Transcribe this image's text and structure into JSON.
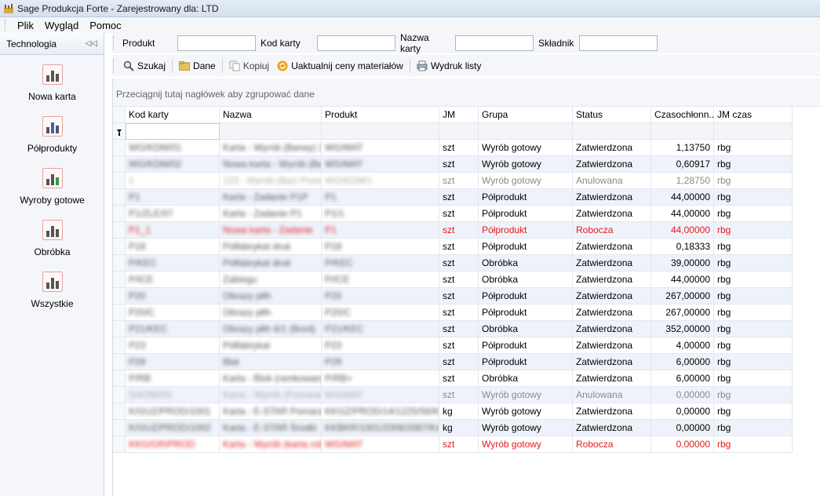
{
  "window": {
    "title": "Sage Produkcja Forte - Zarejestrowany dla: LTD"
  },
  "menu": [
    "Plik",
    "Wygląd",
    "Pomoc"
  ],
  "left_panel": {
    "title": "Technologia",
    "items": [
      {
        "label": "Nowa karta"
      },
      {
        "label": "Półprodukty"
      },
      {
        "label": "Wyroby gotowe"
      },
      {
        "label": "Obróbka"
      },
      {
        "label": "Wszystkie"
      }
    ]
  },
  "search": {
    "produkt_label": "Produkt",
    "produkt_value": "",
    "kod_label": "Kod karty",
    "kod_value": "",
    "nazwa_label": "Nazwa karty",
    "nazwa_value": "",
    "skladnik_label": "Składnik",
    "skladnik_value": ""
  },
  "toolbar": {
    "szukaj": "Szukaj",
    "dane": "Dane",
    "kopiuj": "Kopiuj",
    "uaktualnij": "Uaktualnij ceny materiałów",
    "wydruk": "Wydruk listy"
  },
  "grid": {
    "group_hint": "Przeciągnij tutaj nagłówek aby zgrupować dane",
    "columns": [
      "Kod karty",
      "Nazwa",
      "Produkt",
      "JM",
      "Grupa",
      "Status",
      "Czasochłonn...",
      "JM czas"
    ],
    "rows": [
      {
        "kod": "WG/KDM/01",
        "nazwa": "Karta - Wyrób (Barwy) 1",
        "produkt": "WG/MAT",
        "jm": "szt",
        "grupa": "Wyrób gotowy",
        "status": "Zatwierdzona",
        "czas": "1,13750",
        "jmczas": "rbg",
        "state": "normal"
      },
      {
        "kod": "WG/KDM/02",
        "nazwa": "Nowa karta - Wyrób (Bar)",
        "produkt": "WG/MAT",
        "jm": "szt",
        "grupa": "Wyrób gotowy",
        "status": "Zatwierdzona",
        "czas": "0,60917",
        "jmczas": "rbg",
        "state": "normal"
      },
      {
        "kod": "1",
        "nazwa": "123 - Wyrób (Bar) Pomar",
        "produkt": "WG/KDM/1",
        "jm": "szt",
        "grupa": "Wyrób gotowy",
        "status": "Anulowana",
        "czas": "1,28750",
        "jmczas": "rbg",
        "state": "gray"
      },
      {
        "kod": "P1",
        "nazwa": "Karta - Zadanie P1P",
        "produkt": "P1",
        "jm": "szt",
        "grupa": "Półprodukt",
        "status": "Zatwierdzona",
        "czas": "44,00000",
        "jmczas": "rbg",
        "state": "normal"
      },
      {
        "kod": "P1/ZLE/07",
        "nazwa": "Karta - Zadanie P1",
        "produkt": "P1/1",
        "jm": "szt",
        "grupa": "Półprodukt",
        "status": "Zatwierdzona",
        "czas": "44,00000",
        "jmczas": "rbg",
        "state": "normal"
      },
      {
        "kod": "P1_1",
        "nazwa": "Nowa karta - Zadanie",
        "produkt": "P1",
        "jm": "szt",
        "grupa": "Półprodukt",
        "status": "Robocza",
        "czas": "44,00000",
        "jmczas": "rbg",
        "state": "red"
      },
      {
        "kod": "P18",
        "nazwa": "Półfabrykat druk",
        "produkt": "P18",
        "jm": "szt",
        "grupa": "Półprodukt",
        "status": "Zatwierdzona",
        "czas": "0,18333",
        "jmczas": "rbg",
        "state": "normal"
      },
      {
        "kod": "P/KEC",
        "nazwa": "Półfabrykat druk",
        "produkt": "P/KEC",
        "jm": "szt",
        "grupa": "Obróbka",
        "status": "Zatwierdzona",
        "czas": "39,00000",
        "jmczas": "rbg",
        "state": "normal"
      },
      {
        "kod": "P/ICE",
        "nazwa": "Zabiegu",
        "produkt": "P/ICE",
        "jm": "szt",
        "grupa": "Obróbka",
        "status": "Zatwierdzona",
        "czas": "44,00000",
        "jmczas": "rbg",
        "state": "normal"
      },
      {
        "kod": "P20",
        "nazwa": "Obrazy płth",
        "produkt": "P20",
        "jm": "szt",
        "grupa": "Półprodukt",
        "status": "Zatwierdzona",
        "czas": "267,00000",
        "jmczas": "rbg",
        "state": "normal"
      },
      {
        "kod": "P20/C",
        "nazwa": "Obrazy płth",
        "produkt": "P20/C",
        "jm": "szt",
        "grupa": "Półprodukt",
        "status": "Zatwierdzona",
        "czas": "267,00000",
        "jmczas": "rbg",
        "state": "normal"
      },
      {
        "kod": "P21/KEC",
        "nazwa": "Obrazy płth 6/1 (Bord)",
        "produkt": "P21/KEC",
        "jm": "szt",
        "grupa": "Obróbka",
        "status": "Zatwierdzona",
        "czas": "352,00000",
        "jmczas": "rbg",
        "state": "normal"
      },
      {
        "kod": "P23",
        "nazwa": "Półfabrykat",
        "produkt": "P23",
        "jm": "szt",
        "grupa": "Półprodukt",
        "status": "Zatwierdzona",
        "czas": "4,00000",
        "jmczas": "rbg",
        "state": "normal"
      },
      {
        "kod": "P29",
        "nazwa": "Blat",
        "produkt": "P29",
        "jm": "szt",
        "grupa": "Półprodukt",
        "status": "Zatwierdzona",
        "czas": "6,00000",
        "jmczas": "rbg",
        "state": "normal"
      },
      {
        "kod": "P/RB",
        "nazwa": "Karta - Blok (ramkowany)",
        "produkt": "P/RB+",
        "jm": "szt",
        "grupa": "Obróbka",
        "status": "Zatwierdzona",
        "czas": "6,00000",
        "jmczas": "rbg",
        "state": "normal"
      },
      {
        "kod": "S/KDM/03",
        "nazwa": "Karta - Wyrób (Pomaranc)",
        "produkt": "WG/MAT",
        "jm": "szt",
        "grupa": "Wyrób gotowy",
        "status": "Anulowana",
        "czas": "0,00000",
        "jmczas": "rbg",
        "state": "gray"
      },
      {
        "kod": "K/GUZ/PROD/1001",
        "nazwa": "Karta - E-STAR Pomara",
        "produkt": "KKGZ/PROD/14/1225/56/KB",
        "jm": "kg",
        "grupa": "Wyrób gotowy",
        "status": "Zatwierdzona",
        "czas": "0,00000",
        "jmczas": "rbg",
        "state": "normal"
      },
      {
        "kod": "K/GUZ/PROD/1002",
        "nazwa": "Karta - E-STAR Środki",
        "produkt": "KKBKR/1001/2006/2067/KA",
        "jm": "kg",
        "grupa": "Wyrób gotowy",
        "status": "Zatwierdzona",
        "czas": "0,00000",
        "jmczas": "rbg",
        "state": "normal"
      },
      {
        "kod": "KKG/GR/PROD",
        "nazwa": "Karta - Wyrób (karta rob)",
        "produkt": "WG/MAT",
        "jm": "szt",
        "grupa": "Wyrób gotowy",
        "status": "Robocza",
        "czas": "0,00000",
        "jmczas": "rbg",
        "state": "red"
      }
    ]
  },
  "colors": {
    "red_status": "#e31b1b",
    "gray_status": "#8a8a8a",
    "alt_row": "#eef3fb"
  }
}
